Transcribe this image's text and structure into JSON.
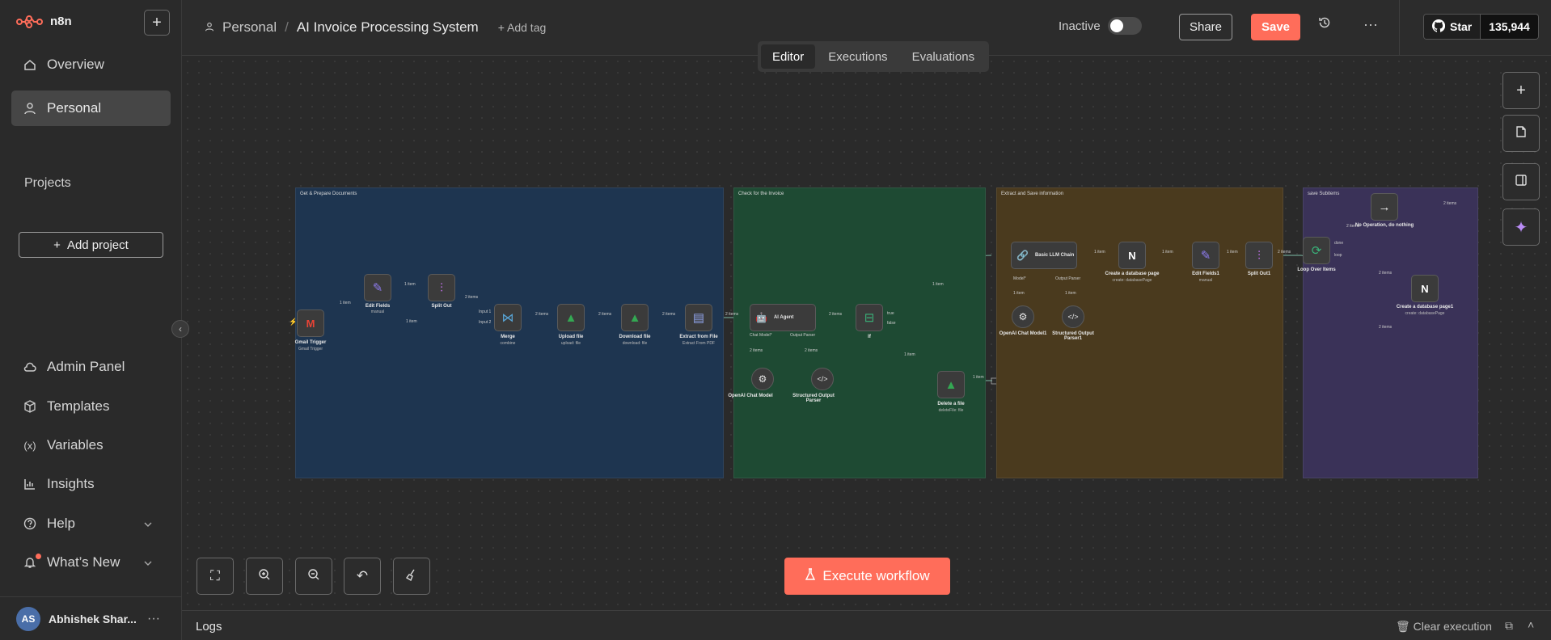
{
  "app": {
    "name": "n8n"
  },
  "sidebar": {
    "nav": [
      {
        "label": "Overview"
      },
      {
        "label": "Personal"
      }
    ],
    "projects_heading": "Projects",
    "add_project": "Add project",
    "bottom": [
      {
        "label": "Admin Panel"
      },
      {
        "label": "Templates"
      },
      {
        "label": "Variables"
      },
      {
        "label": "Insights"
      },
      {
        "label": "Help"
      },
      {
        "label": "What’s New"
      }
    ],
    "user": {
      "initials": "AS",
      "name": "Abhishek Shar..."
    }
  },
  "header": {
    "breadcrumb_project": "Personal",
    "breadcrumb_sep": "/",
    "workflow_name": "AI Invoice Processing System",
    "add_tag": "+ Add tag",
    "status_label": "Inactive",
    "share": "Share",
    "save": "Save",
    "github": {
      "star": "Star",
      "count": "135,944"
    }
  },
  "tabs": [
    {
      "label": "Editor",
      "active": true
    },
    {
      "label": "Executions"
    },
    {
      "label": "Evaluations"
    }
  ],
  "groups": [
    {
      "title": "Get & Prepare Documents"
    },
    {
      "title": "Check for the Invoice"
    },
    {
      "title": "Extract and Save information"
    },
    {
      "title": "save Subitems"
    }
  ],
  "nodes": [
    {
      "label": "Gmail Trigger",
      "sub": "Gmail Trigger",
      "icon": "gmail-icon"
    },
    {
      "label": "Edit Fields",
      "sub": "manual",
      "icon": "pencil-icon"
    },
    {
      "label": "Split Out",
      "sub": "",
      "icon": "split-icon"
    },
    {
      "label": "Merge",
      "sub": "combine",
      "icon": "merge-icon"
    },
    {
      "label": "Upload file",
      "sub": "upload: file",
      "icon": "drive-icon"
    },
    {
      "label": "Download file",
      "sub": "download: file",
      "icon": "drive-icon"
    },
    {
      "label": "Extract from File",
      "sub": "Extract From PDF",
      "icon": "file-extract-icon"
    },
    {
      "label": "AI Agent",
      "sub": "",
      "icon": "robot-icon"
    },
    {
      "label": "OpenAI Chat Model",
      "sub": "",
      "icon": "openai-icon"
    },
    {
      "label": "Structured Output Parser",
      "sub": "",
      "icon": "code-icon"
    },
    {
      "label": "If",
      "sub": "",
      "icon": "if-icon"
    },
    {
      "label": "Delete a file",
      "sub": "deleteFile: file",
      "icon": "drive-icon"
    },
    {
      "label": "Basic LLM Chain",
      "sub": "",
      "icon": "chain-icon"
    },
    {
      "label": "OpenAI Chat Model1",
      "sub": "",
      "icon": "openai-icon"
    },
    {
      "label": "Structured Output Parser1",
      "sub": "",
      "icon": "code-icon"
    },
    {
      "label": "Create a database page",
      "sub": "create: databasePage",
      "icon": "notion-icon"
    },
    {
      "label": "Edit Fields1",
      "sub": "manual",
      "icon": "pencil-icon"
    },
    {
      "label": "Split Out1",
      "sub": "",
      "icon": "split-icon"
    },
    {
      "label": "Loop Over Items",
      "sub": "",
      "icon": "loop-icon"
    },
    {
      "label": "No Operation, do nothing",
      "sub": "",
      "icon": "arrow-right-icon"
    },
    {
      "label": "Create a database page1",
      "sub": "create: databasePage",
      "icon": "notion-icon"
    }
  ],
  "edge_labels": {
    "one": "1 item",
    "two": "2 items",
    "in1": "Input 1",
    "in2": "Input 2",
    "t": "true",
    "f": "false",
    "done": "done",
    "loop": "loop",
    "model": "Model*",
    "chat": "Chat Model*",
    "parser": "Output Parser"
  },
  "execute": "Execute workflow",
  "logs": {
    "title": "Logs",
    "clear": "Clear execution"
  },
  "colors": {
    "accent": "#ff6d5a",
    "group1": "#1e3550",
    "group2": "#1e4a33",
    "group3": "#4a3a1e",
    "group4": "#3a3258"
  }
}
